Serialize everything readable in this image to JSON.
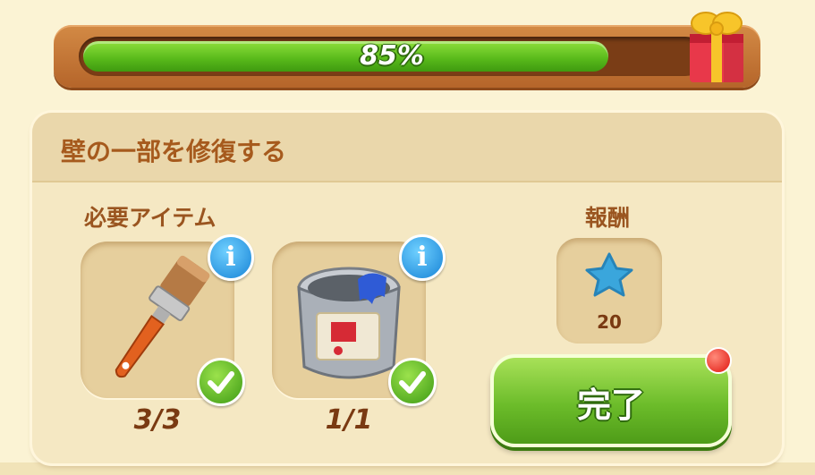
{
  "progress": {
    "value": 0.85,
    "label": "85%"
  },
  "gift": {
    "icon": "gift-box-icon"
  },
  "task": {
    "title": "壁の一部を修復する",
    "required_label": "必要アイテム",
    "items": [
      {
        "icon": "paint-brush-icon",
        "count": "3/3",
        "complete": true
      },
      {
        "icon": "paint-can-icon",
        "count": "1/1",
        "complete": true
      }
    ],
    "reward": {
      "label": "報酬",
      "icon": "blue-star-icon",
      "amount": "20"
    },
    "complete_label": "完了"
  },
  "colors": {
    "progress_fill": "#57b81a",
    "button": "#6cbc2a",
    "title": "#a65a1d"
  }
}
